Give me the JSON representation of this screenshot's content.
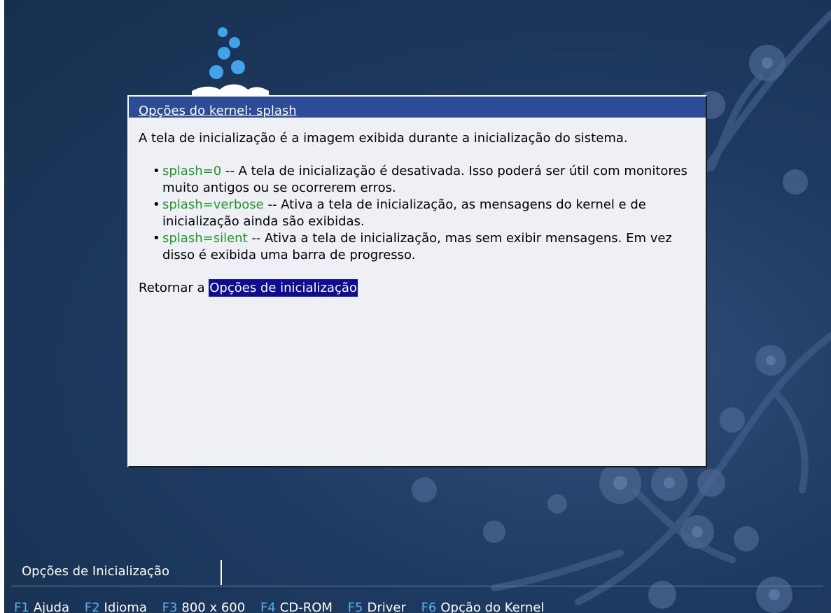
{
  "dialog": {
    "title": "Opções do kernel: splash",
    "intro": "A tela de inicialização é a imagem exibida durante a inicialização do sistema.",
    "options": [
      {
        "keyword": "splash=0",
        "description": " -- A tela de inicialização é desativada. Isso poderá ser útil com monitores muito antigos ou se ocorrerem erros."
      },
      {
        "keyword": "splash=verbose",
        "description": " -- Ativa a tela de inicialização, as mensagens do kernel e de inicialização ainda são exibidas."
      },
      {
        "keyword": "splash=silent",
        "description": " -- Ativa a tela de inicialização, mas sem exibir mensagens. Em vez disso é exibida uma barra de progresso."
      }
    ],
    "back_prefix": "Retornar a ",
    "back_link": "Opções de inicialização"
  },
  "boot_menu": {
    "label": "Opções de Inicialização"
  },
  "function_keys": [
    {
      "key": "F1",
      "label": "Ajuda"
    },
    {
      "key": "F2",
      "label": "Idioma"
    },
    {
      "key": "F3",
      "label": "800 x 600"
    },
    {
      "key": "F4",
      "label": "CD-ROM"
    },
    {
      "key": "F5",
      "label": "Driver"
    },
    {
      "key": "F6",
      "label": "Opção do Kernel"
    }
  ],
  "colors": {
    "background": "#1f3a62",
    "title_bar": "#2c4c98",
    "keyword": "#1f9a2a",
    "link_selected_bg": "#0c0c96",
    "fkey": "#4fb3ef"
  }
}
